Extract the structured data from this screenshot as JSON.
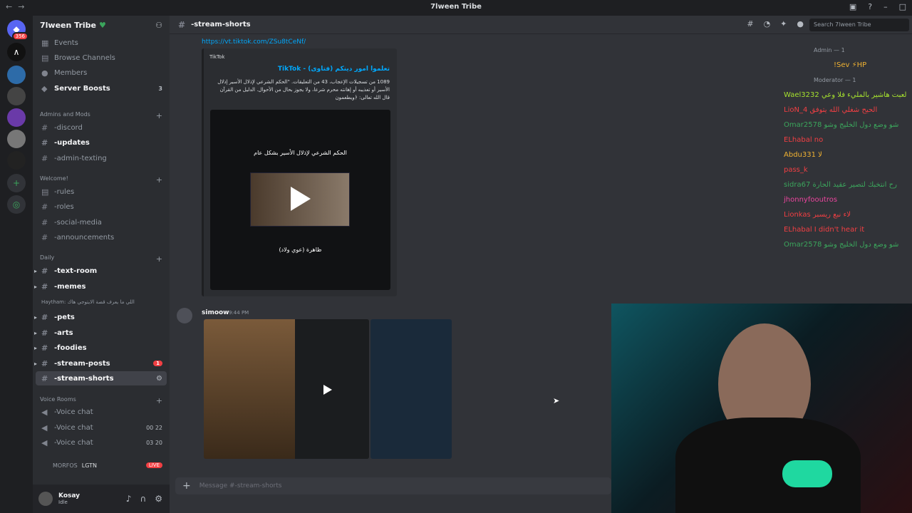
{
  "window": {
    "title": "7lween Tribe"
  },
  "server": {
    "name": "7lween Tribe",
    "boosts_count": "3"
  },
  "top_items": [
    {
      "label": "Events",
      "icon": "calendar-icon"
    },
    {
      "label": "Browse Channels",
      "icon": "browse-icon"
    },
    {
      "label": "Members",
      "icon": "members-icon"
    },
    {
      "label": "Server Boosts",
      "icon": "boost-icon"
    }
  ],
  "categories": {
    "admins": "Admins and Mods",
    "welcome": "Welcome!",
    "daily": "Daily",
    "voice": "Voice Rooms"
  },
  "channels": {
    "discord": "-discord",
    "updates": "-updates",
    "admin_texting": "-admin-texting",
    "rules": "-rules",
    "roles": "-roles",
    "social_media": "-social-media",
    "announcements": "-announcements",
    "text_room": "-text-room",
    "memes": "-memes",
    "memes_preview": "Haytham: اللي ما يعرف قصة الايتوجي هاك",
    "pets": "-pets",
    "arts": "-arts",
    "foodies": "-foodies",
    "stream_posts": "-stream-posts",
    "stream_posts_badge": "1",
    "stream_shorts": "-stream-shorts",
    "voice1": "-Voice chat",
    "voice2": "-Voice chat",
    "voice2_counts": "00  22",
    "voice3": "-Voice chat",
    "voice3_counts": "03  20",
    "voice_user": "MORFOS",
    "voice_user_tag": "LGTN",
    "live_label": "LIVE"
  },
  "user": {
    "name": "Kosay",
    "status": "Idle"
  },
  "header": {
    "channel": "-stream-shorts",
    "search_placeholder": "Search 7lween Tribe"
  },
  "message1": {
    "link": "https://vt.tiktok.com/ZSu8tCeNf/",
    "provider": "TikTok",
    "title": "TikTok - تعلموا امور دينكم (فتاوى)",
    "desc": "1089 من تسجيلات الإعجاب، 43 من التعليقات. \"الحكم الشرعي لإذلال الأسير إذلال الأسير أو تعذيبه أو إهانته محرم شرعا، ولا يجوز بحال من الأحوال. الدليل من القرآن قال الله تعالى: ﴿ويطعمون",
    "video_caption": "الحكم الشرعي لإذلال الأسير بشكل عام",
    "video_caption2": "ظاهرة (عوي ولاد)"
  },
  "message2": {
    "author": "simoow",
    "time": "9:44 PM"
  },
  "composer": {
    "placeholder": "Message #-stream-shorts"
  },
  "overlay_chat": [
    {
      "text": "Admin — 1",
      "color": "#949ba4"
    },
    {
      "text": "!Sev ⚡HP",
      "color": "#f0b232"
    },
    {
      "text": "Moderator — 1",
      "color": "#949ba4"
    },
    {
      "text": "Wael3232 لعبت هاشير بالمليء فلا وعي",
      "color": "#a6e22e"
    },
    {
      "text": "LioN_4 الحيح شغلي الله يتوفق",
      "color": "#f23f43"
    },
    {
      "text": "Omar2578 شو وضع دول الخليج وشو",
      "color": "#3ba55c"
    },
    {
      "text": "ELhabal no",
      "color": "#f23f43"
    },
    {
      "text": "Abdu331 لا",
      "color": "#f0b232"
    },
    {
      "text": "pass_k",
      "color": "#f23f43"
    },
    {
      "text": "sidra67 رح انتخبك لتصير عقيد الحارة",
      "color": "#3ba55c"
    },
    {
      "text": "jhonnyfooutros",
      "color": "#eb459e"
    },
    {
      "text": "Lionkas لاء نبع ريسبر",
      "color": "#f23f43"
    },
    {
      "text": "ELhabal I didn't hear it",
      "color": "#f23f43"
    },
    {
      "text": "Omar2578 شو وضع دول الخليج وشو",
      "color": "#3ba55c"
    }
  ]
}
